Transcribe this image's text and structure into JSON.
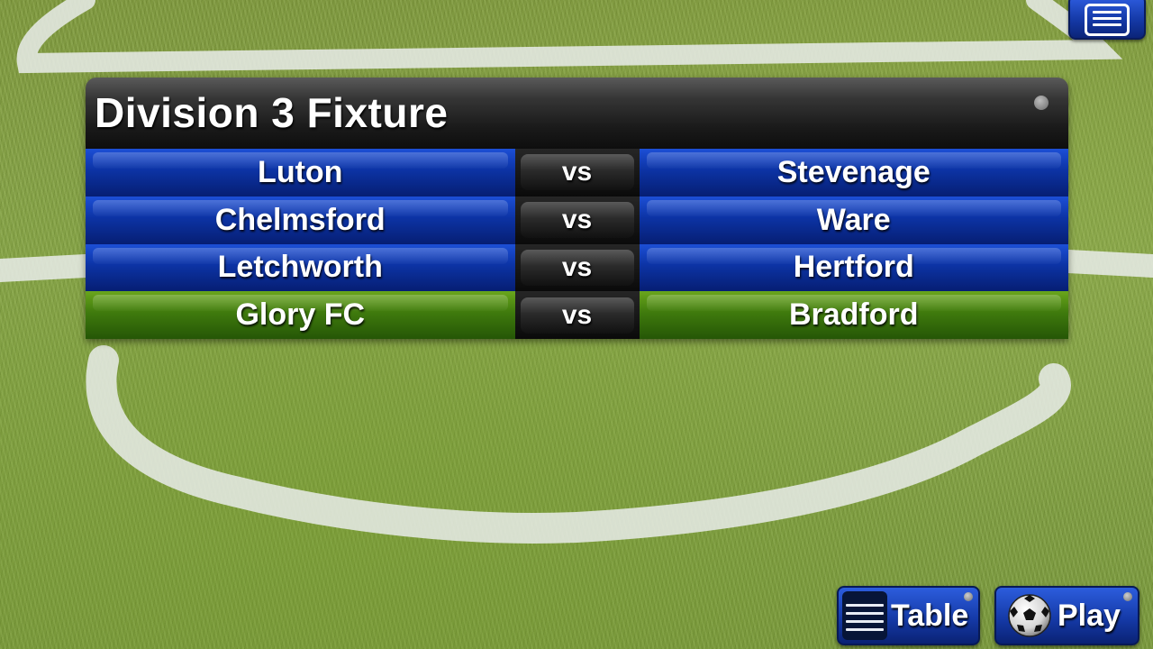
{
  "header": {
    "title": "Division 3 Fixture"
  },
  "top_menu": {
    "icon": "list-icon"
  },
  "fixtures": [
    {
      "home": "Luton",
      "separator": "vs",
      "away": "Stevenage",
      "highlight": false
    },
    {
      "home": "Chelmsford",
      "separator": "vs",
      "away": "Ware",
      "highlight": false
    },
    {
      "home": "Letchworth",
      "separator": "vs",
      "away": "Hertford",
      "highlight": false
    },
    {
      "home": "Glory FC",
      "separator": "vs",
      "away": "Bradford",
      "highlight": true
    }
  ],
  "buttons": {
    "table_label": "Table",
    "table_icon": "menu-lines-icon",
    "play_label": "Play",
    "play_icon": "soccer-ball-icon"
  },
  "colors": {
    "row_blue": "#0c33a4",
    "row_highlight_green": "#3f7a0d",
    "button_blue": "#153aa8",
    "header_dark": "#1a1a1a"
  }
}
